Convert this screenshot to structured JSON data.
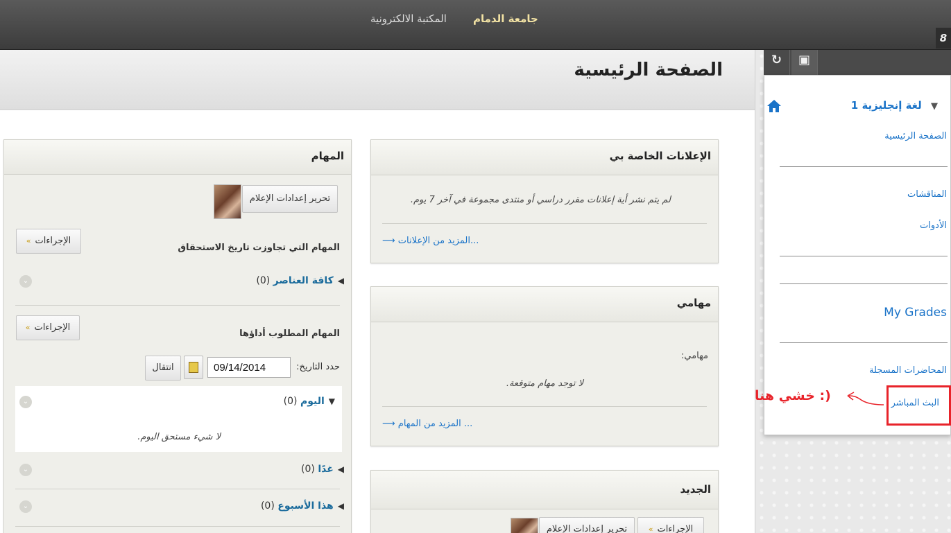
{
  "topbar": {
    "tab_institution": "جامعة الدمام",
    "tab_library": "المكتبة الالكترونية",
    "corner_icon": "8"
  },
  "page": {
    "title": "الصفحة الرئيسية"
  },
  "course_menu": {
    "toolbar": {
      "refresh_icon": "↻",
      "course_icon": "▣"
    },
    "course_name": "لغة إنجليزية 1",
    "items": [
      {
        "label": "الصفحة الرئيسية"
      },
      {
        "label": "المناقشات"
      },
      {
        "label": "الأدوات"
      },
      {
        "label": "My Grades"
      },
      {
        "label": "المحاضرات المسجلة"
      },
      {
        "label": "البث المباشر"
      }
    ],
    "annotation": "خشي هنا :)"
  },
  "announcements": {
    "title": "الإعلانات الخاصة بي",
    "empty_text": "لم يتم نشر أية إعلانات مقرر دراسي أو منتدى مجموعة في آخر 7 يوم.",
    "more_link": "المزيد من الإعلانات..."
  },
  "my_tasks": {
    "title": "مهامي",
    "label": "مهامي:",
    "empty_text": "لا توجد مهام متوقعة.",
    "more_link": "المزيد من المهام ..."
  },
  "whats_new": {
    "title": "الجديد",
    "edit_button": "تحرير إعدادات الإعلام",
    "actions_button": "الإجراءات"
  },
  "tasks": {
    "title": "المهام",
    "edit_button": "تحرير إعدادات الإعلام",
    "overdue": {
      "title": "المهام التي تجاوزت تاريخ الاستحقاق",
      "actions_button": "الإجراءات",
      "group_all": "كافة العناصر",
      "group_all_count": "(0)"
    },
    "due": {
      "title": "المهام المطلوب أداؤها",
      "actions_button": "الإجراءات",
      "date_label": "حدد التاريخ:",
      "date_value": "09/14/2014",
      "go_button": "انتقال",
      "today": "اليوم",
      "today_count": "(0)",
      "today_empty": "لا شيء مستحق اليوم.",
      "tomorrow": "غدًا",
      "tomorrow_count": "(0)",
      "this_week": "هذا الأسبوع",
      "this_week_count": "(0)"
    }
  }
}
